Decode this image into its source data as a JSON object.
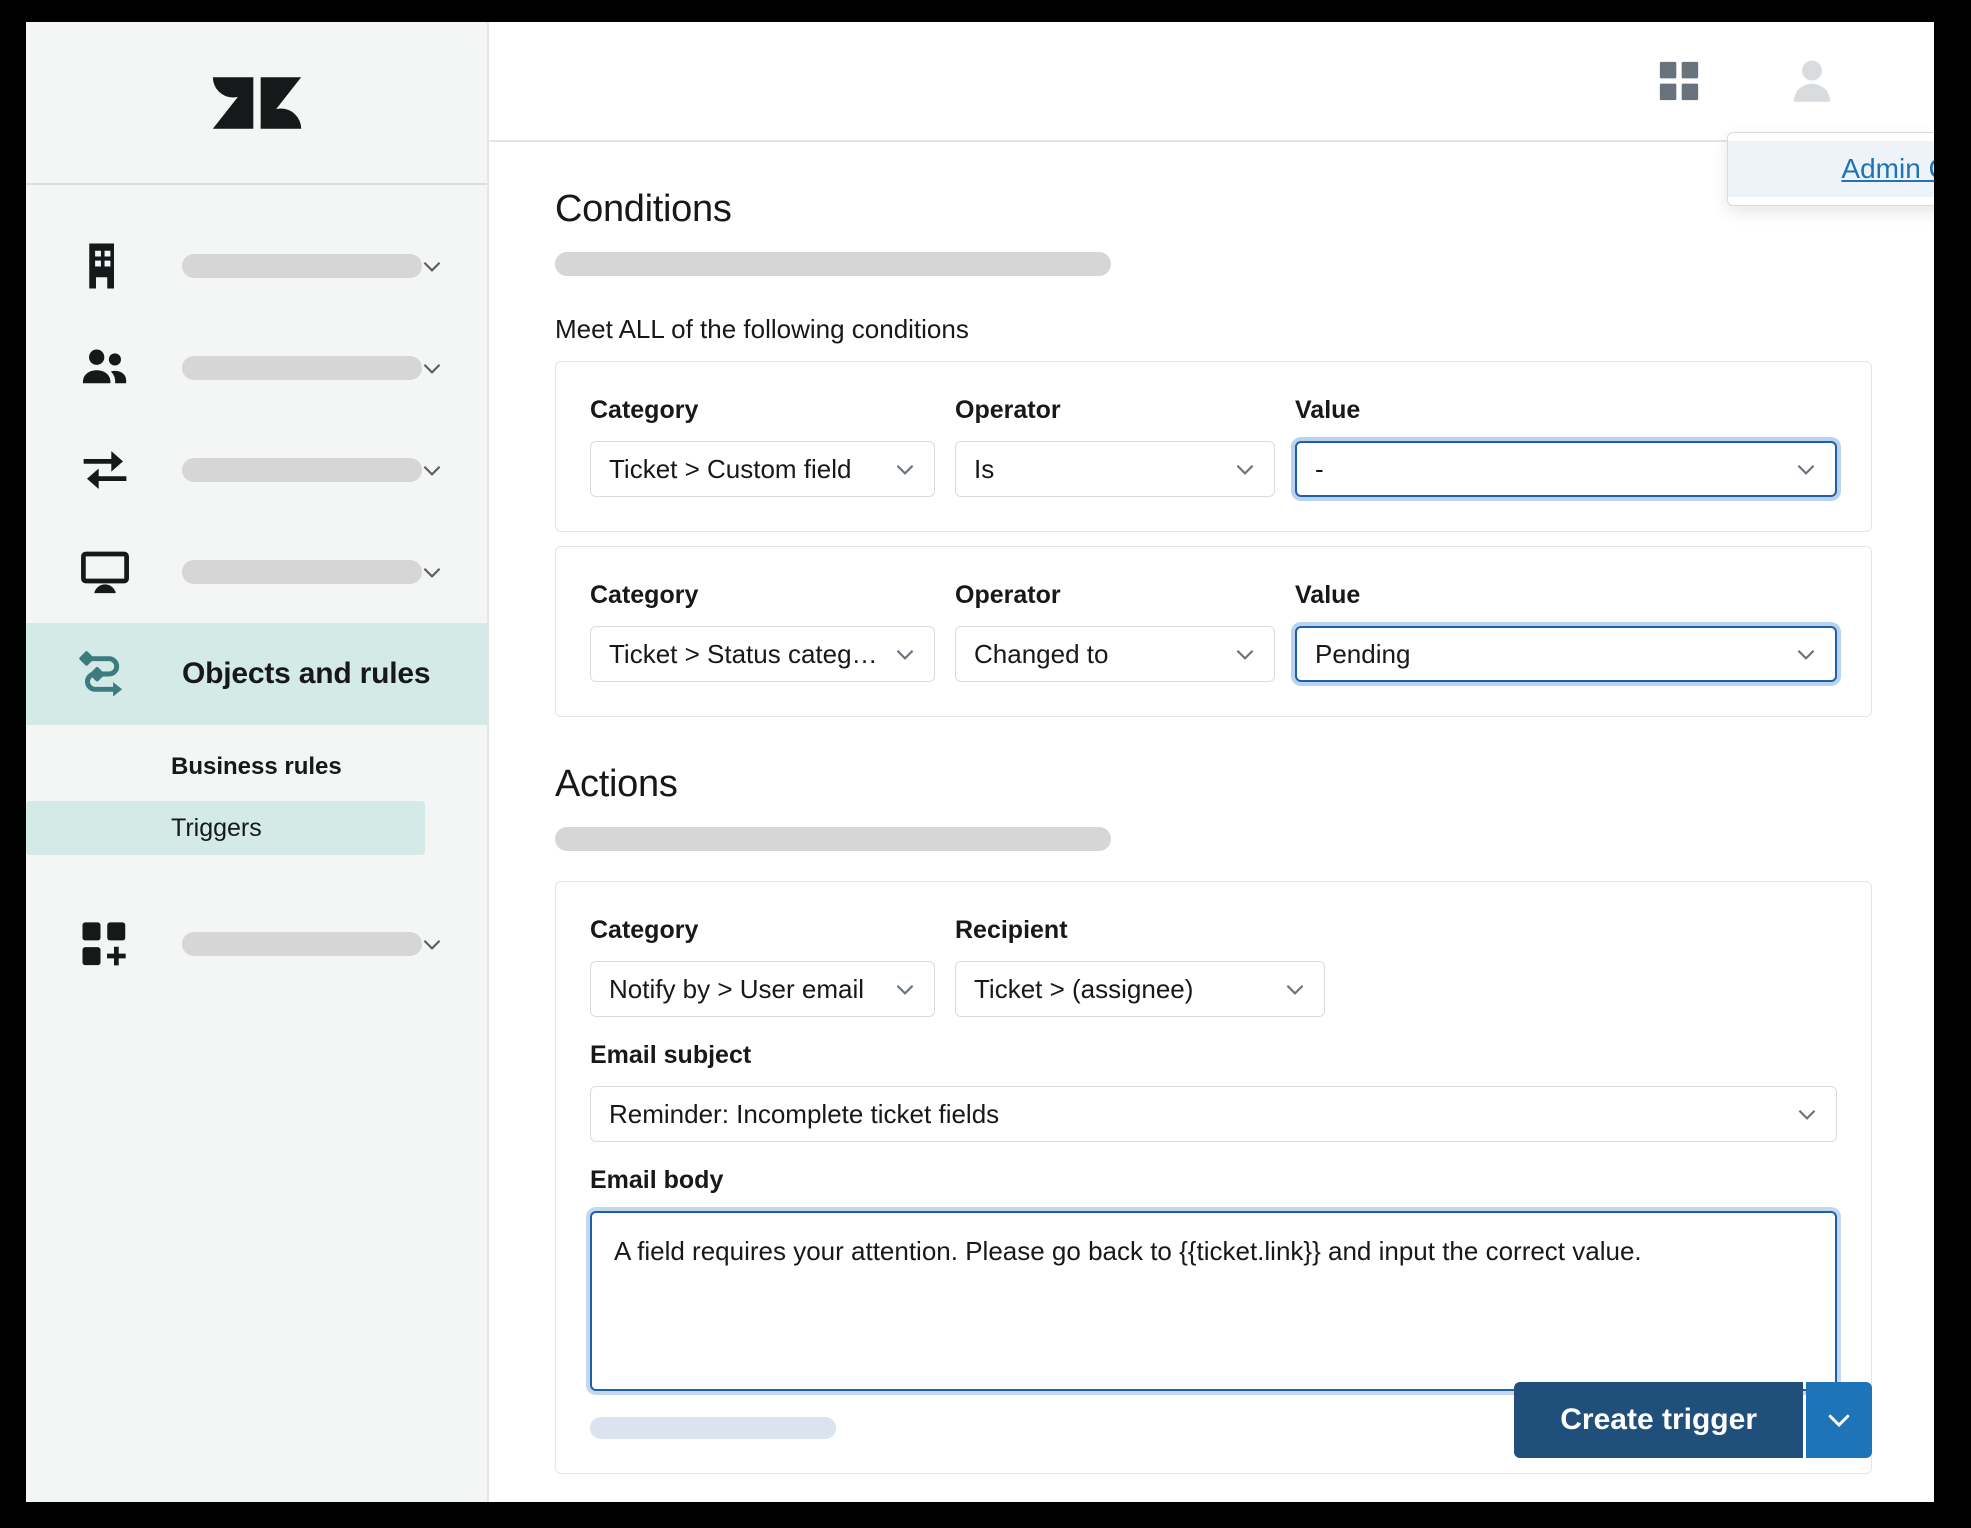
{
  "window": {
    "brand_logo": "zendesk-logo"
  },
  "sidebar": {
    "nav_items": [
      {
        "icon": "building-icon",
        "label": ""
      },
      {
        "icon": "people-icon",
        "label": ""
      },
      {
        "icon": "arrows-exchange-icon",
        "label": ""
      },
      {
        "icon": "monitor-icon",
        "label": ""
      }
    ],
    "selected_item": {
      "icon": "objects-rules-icon",
      "label": "Objects and rules"
    },
    "sub_header": "Business rules",
    "sub_items": [
      {
        "label": "Triggers",
        "active": true
      }
    ],
    "bottom_item": {
      "icon": "apps-add-icon",
      "label": ""
    }
  },
  "topbar": {
    "grid_icon": "grid-apps-icon",
    "avatar_icon": "user-avatar-icon",
    "popover": {
      "link_label": "Admin Center"
    }
  },
  "conditions": {
    "heading": "Conditions",
    "meet_text": "Meet ALL of the following conditions",
    "labels": {
      "category": "Category",
      "operator": "Operator",
      "value": "Value"
    },
    "rows": [
      {
        "category": "Ticket > Custom field",
        "operator": "Is",
        "value": "-",
        "value_focused": true
      },
      {
        "category": "Ticket > Status category",
        "operator": "Changed to",
        "value": "Pending",
        "value_focused": true
      }
    ]
  },
  "actions": {
    "heading": "Actions",
    "labels": {
      "category": "Category",
      "recipient": "Recipient",
      "email_subject": "Email subject",
      "email_body": "Email body"
    },
    "category": "Notify by > User email",
    "recipient": "Ticket > (assignee)",
    "email_subject": "Reminder: Incomplete ticket fields",
    "email_body": "A field requires your attention. Please go back to {{ticket.link}} and input the correct value."
  },
  "footer": {
    "primary_label": "Create trigger",
    "split_icon": "chevron-down-icon"
  },
  "colors": {
    "accent_teal": "#3d7b7e",
    "selected_bg": "#d3eae7",
    "link_blue": "#1f73b7",
    "focus_blue": "#1f5fa9",
    "primary_button": "#1f4f7a"
  }
}
